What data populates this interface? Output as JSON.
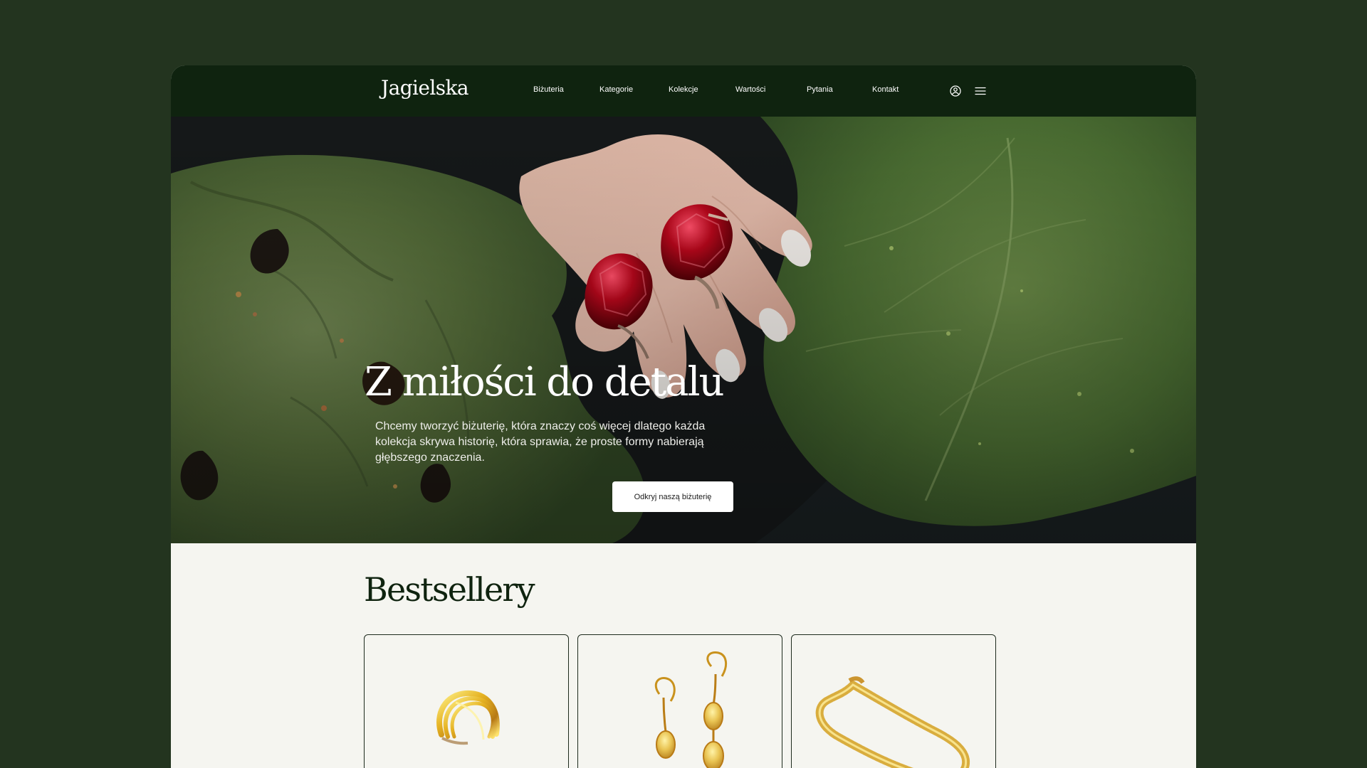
{
  "brand": {
    "name": "Jagielska"
  },
  "nav": {
    "items": [
      {
        "label": "Biżuteria"
      },
      {
        "label": "Kategorie"
      },
      {
        "label": "Kolekcje"
      },
      {
        "label": "Wartości"
      },
      {
        "label": "Pytania"
      },
      {
        "label": "Kontakt"
      }
    ],
    "icons": [
      "user-icon",
      "menu-icon"
    ]
  },
  "hero": {
    "title": "Z miłości do detalu",
    "description": "Chcemy tworzyć biżuterię, która znaczy coś więcej dlatego każda kolekcja skrywa historię, która sprawia, że proste formy nabierają głębszego znaczenia.",
    "button_label": "Odkryj naszą biżuterię"
  },
  "bestsellers": {
    "title": "Bestsellery",
    "products": [
      {
        "image_name": "gold-ring-icon"
      },
      {
        "image_name": "gold-earrings-icon"
      },
      {
        "image_name": "gold-chain-icon"
      }
    ]
  },
  "colors": {
    "page_background": "#23341f",
    "header_background": "#0f230f",
    "content_background": "#f5f5f0",
    "button_background": "#ffffff",
    "text_dark": "#0f230f"
  }
}
